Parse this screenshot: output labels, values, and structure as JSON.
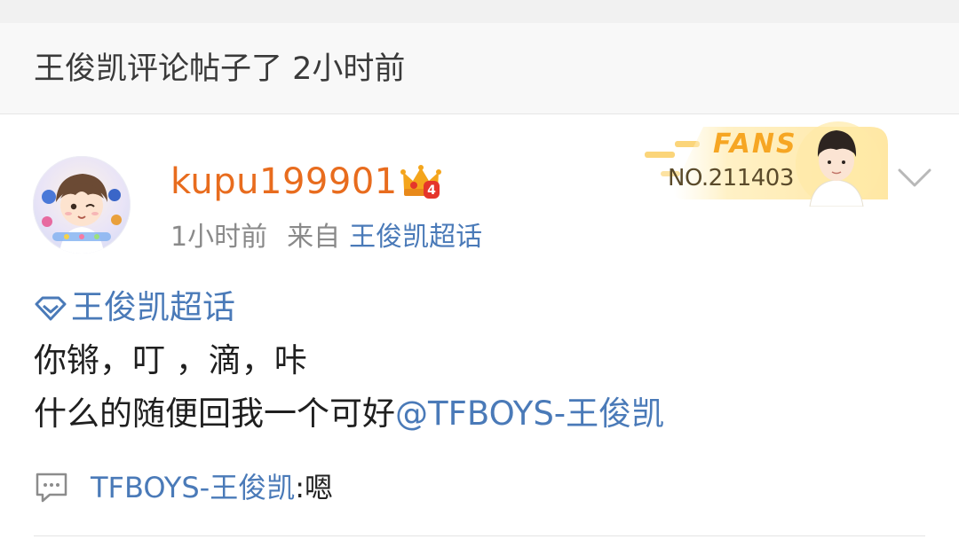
{
  "notice": {
    "text": "王俊凯评论帖子了 2小时前"
  },
  "post": {
    "author": {
      "username": "kupu199901",
      "crown_badge_level": "4"
    },
    "meta": {
      "time": "1小时前",
      "via_label": "来自",
      "via_source": "王俊凯超话"
    },
    "fans_badge": {
      "label": "FANS",
      "number": "NO.211403"
    },
    "topic": "王俊凯超话",
    "body": {
      "line1": "你锵，叮 ，滴，咔",
      "line2_text": "什么的随便回我一个可好",
      "line2_mention": "@TFBOYS-王俊凯"
    },
    "reply": {
      "author": "TFBOYS-王俊凯",
      "separator": ":",
      "text": "嗯"
    }
  },
  "icons": {
    "topic": "diamond-icon",
    "menu": "chevron-down-icon",
    "comment": "comment-icon",
    "crown": "crown-icon"
  },
  "colors": {
    "username": "#e86c1e",
    "link": "#4a7ab8",
    "fans_gold": "#f6a623"
  }
}
